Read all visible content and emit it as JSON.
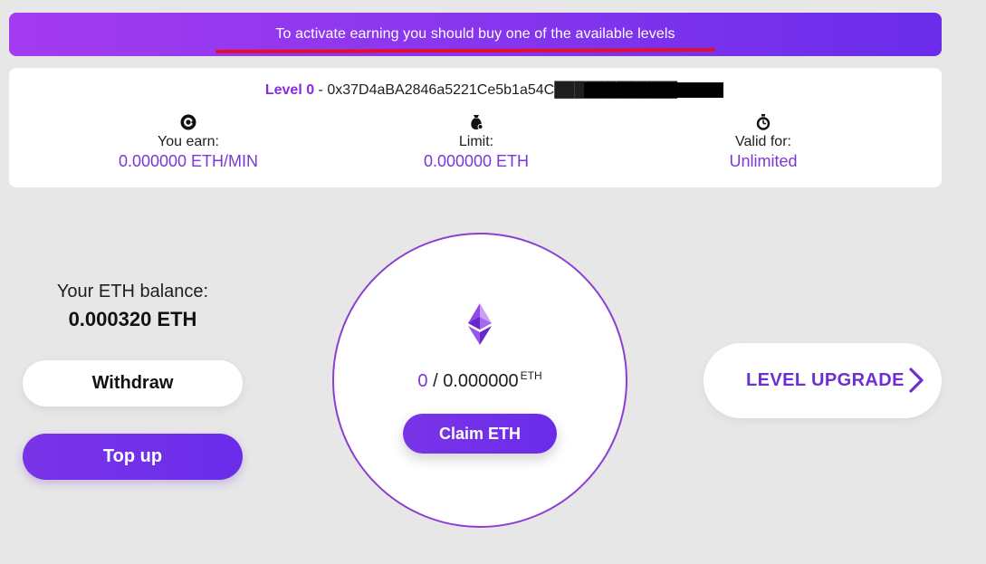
{
  "banner": {
    "text": "To activate earning you should buy one of the available levels"
  },
  "level_card": {
    "level_label": "Level 0",
    "separator": " - ",
    "address": "0x37D4aBA2846a5221Ce5b1a54C████████████2",
    "stats": [
      {
        "icon": "coin-icon",
        "label": "You earn:",
        "value": "0.000000 ETH/MIN"
      },
      {
        "icon": "money-bag-icon",
        "label": "Limit:",
        "value": "0.000000 ETH"
      },
      {
        "icon": "stopwatch-icon",
        "label": "Valid for:",
        "value": "Unlimited"
      }
    ]
  },
  "balance": {
    "label": "Your ETH balance:",
    "value": "0.000320 ETH"
  },
  "buttons": {
    "withdraw": "Withdraw",
    "top_up": "Top up",
    "claim": "Claim ETH",
    "level_upgrade": "LEVEL UPGRADE"
  },
  "claim": {
    "current": "0",
    "slash": " / ",
    "total": "0.000000",
    "unit": "ETH"
  },
  "colors": {
    "accent": "#7a38d6",
    "banner_start": "#a43bf0",
    "banner_end": "#6a2cea",
    "underline": "#e2102e",
    "background": "#e7e7e7"
  }
}
